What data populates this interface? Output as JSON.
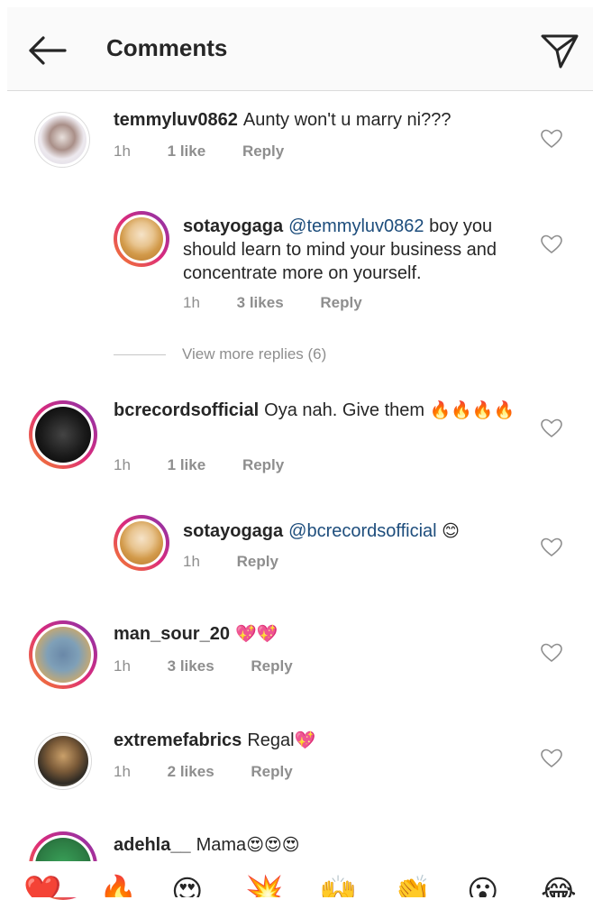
{
  "header": {
    "title": "Comments",
    "back_icon": "back-arrow-icon",
    "send_icon": "send-icon"
  },
  "comments": [
    {
      "username": "temmyluv0862",
      "text": "Aunty won't u marry ni???",
      "time": "1h",
      "likes": "1 like",
      "reply": "Reply"
    },
    {
      "username": "sotayogaga",
      "mention": "@temmyluv0862",
      "text": "boy you should learn to mind your business and concentrate more on yourself.",
      "time": "1h",
      "likes": "3 likes",
      "reply": "Reply"
    },
    {
      "username": "bcrecordsofficial",
      "text": "Oya nah. Give them",
      "emojis": "🔥🔥🔥🔥",
      "time": "1h",
      "likes": "1 like",
      "reply": "Reply"
    },
    {
      "username": "sotayogaga",
      "mention": "@bcrecordsofficial",
      "emojis": "😊",
      "time": "1h",
      "reply": "Reply"
    },
    {
      "username": "man_sour_20",
      "emojis": "💖💖",
      "time": "1h",
      "likes": "3 likes",
      "reply": "Reply"
    },
    {
      "username": "extremefabrics",
      "text": "Regal",
      "emojis": "💖",
      "time": "1h",
      "likes": "2 likes",
      "reply": "Reply"
    },
    {
      "username": "adehla__",
      "text": "Mama",
      "emojis": "😍😍😍"
    }
  ],
  "view_more_replies": "View more replies (6)",
  "emoji_bar": [
    "❤️",
    "🔥",
    "😍",
    "💥",
    "🙌",
    "👏",
    "😮",
    "😂"
  ],
  "colors": {
    "accent_mention": "#1d4d7c",
    "meta_gray": "#8e8e8e",
    "ring_gradient": [
      "#f58529",
      "#dd2a7b",
      "#8134af"
    ]
  }
}
